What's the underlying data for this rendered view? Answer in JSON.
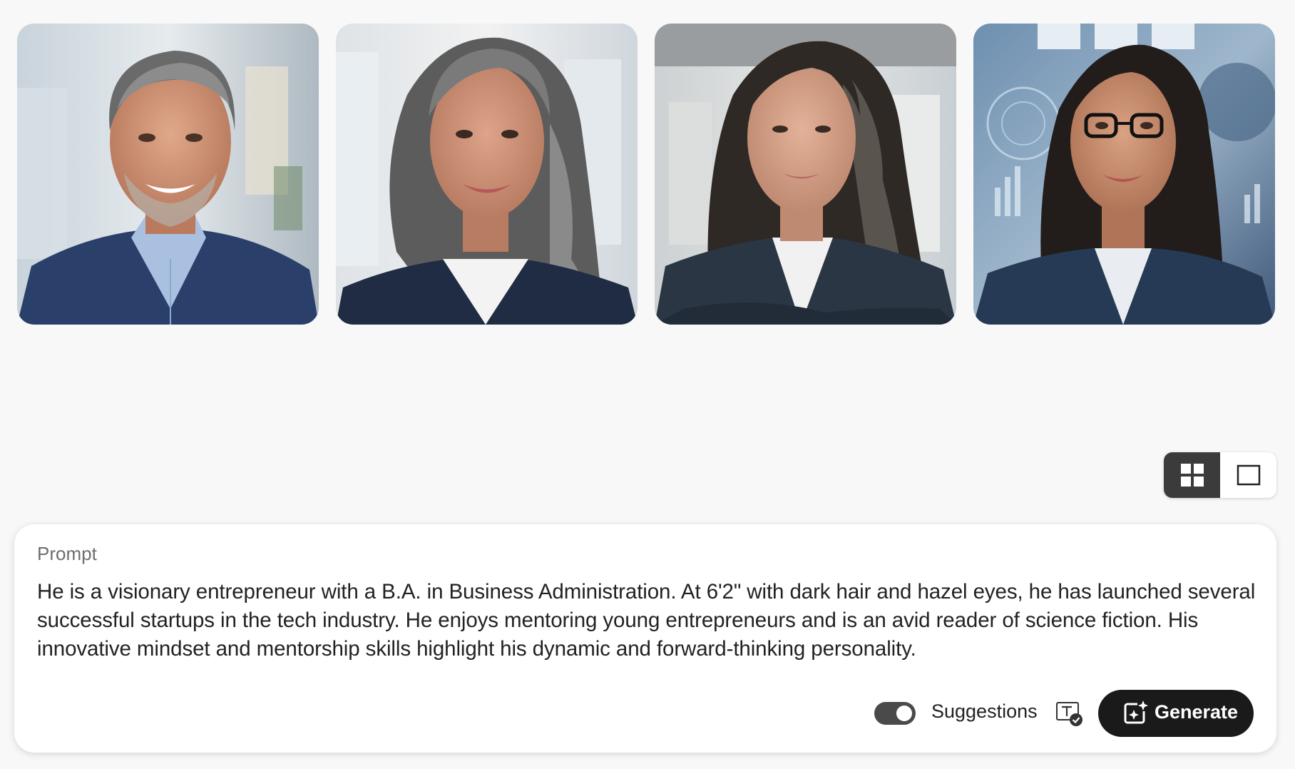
{
  "gallery": {
    "images": [
      {
        "label": "Generated portrait 1 - smiling man with grey hair in navy suit"
      },
      {
        "label": "Generated portrait 2 - smiling woman with long grey hair in navy blazer"
      },
      {
        "label": "Generated portrait 3 - woman with dark wavy hair in office, arms crossed"
      },
      {
        "label": "Generated portrait 4 - woman with glasses and dark hair in futuristic tech background"
      }
    ]
  },
  "view_toggle": {
    "options": [
      "grid-view",
      "single-view"
    ],
    "selected": "grid-view"
  },
  "prompt": {
    "label": "Prompt",
    "text": "He is a visionary entrepreneur with a B.A. in Business Administration. At 6'2\" with dark hair and hazel eyes, he has launched several successful startups in the tech industry. He enjoys mentoring young entrepreneurs and is an avid reader of science fiction. His innovative mindset and mentorship skills highlight his dynamic and forward-thinking personality."
  },
  "controls": {
    "suggestions_label": "Suggestions",
    "suggestions_enabled": true,
    "generate_label": "Generate"
  },
  "colors": {
    "background": "#f8f8f8",
    "panel": "#ffffff",
    "button_dark": "#1a1a1a",
    "toggle_on": "#4a4a4a"
  }
}
